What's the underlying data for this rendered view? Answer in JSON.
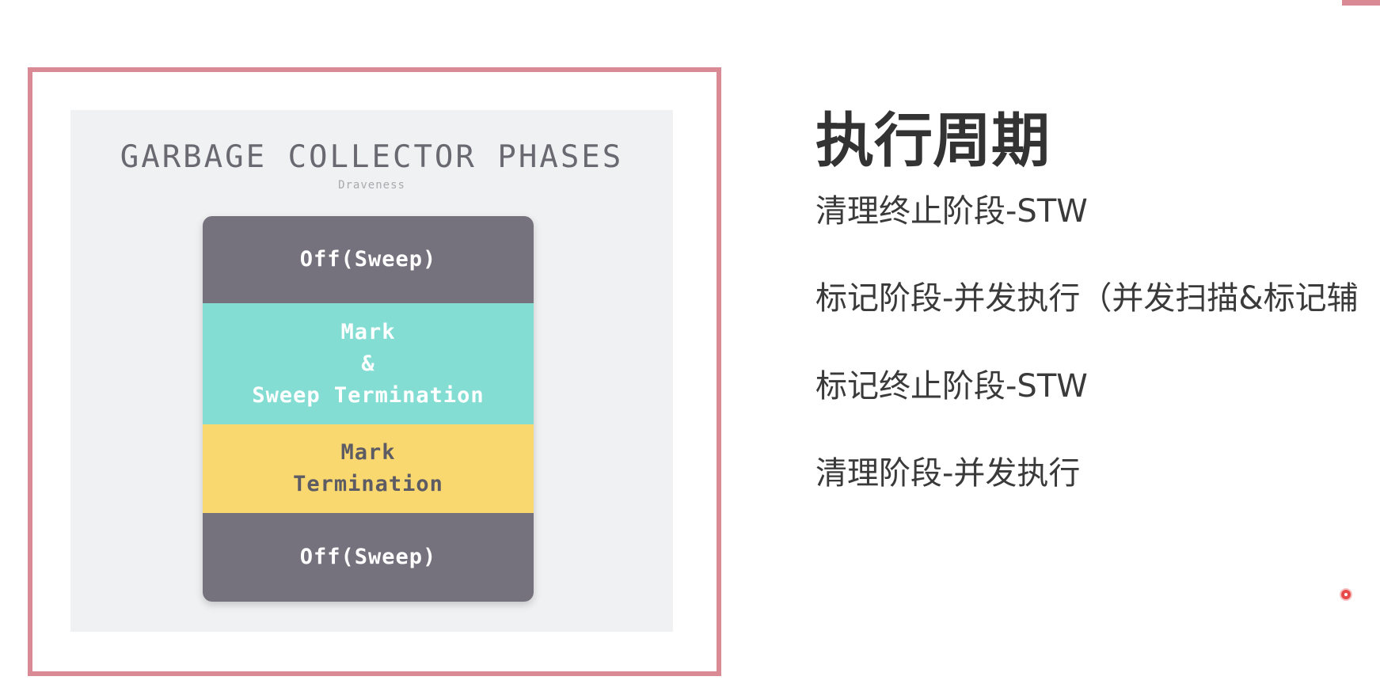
{
  "diagram": {
    "title": "GARBAGE COLLECTOR PHASES",
    "author": "Draveness",
    "phases": [
      {
        "label": "Off(Sweep)",
        "color": "#75727d"
      },
      {
        "label": "Mark\n&\nSweep Termination",
        "color": "#84ddd3"
      },
      {
        "label": "Mark\nTermination",
        "color": "#f9d86f"
      },
      {
        "label": "Off(Sweep)",
        "color": "#75727d"
      }
    ]
  },
  "content": {
    "heading": "执行周期",
    "items": [
      "清理终止阶段-STW",
      "标记阶段-并发执行（并发扫描&标记辅",
      "标记终止阶段-STW",
      "清理阶段-并发执行"
    ]
  },
  "colors": {
    "frame_border": "#d98a94",
    "panel_bg": "#f0f1f3",
    "cursor": "#e84a4a"
  }
}
